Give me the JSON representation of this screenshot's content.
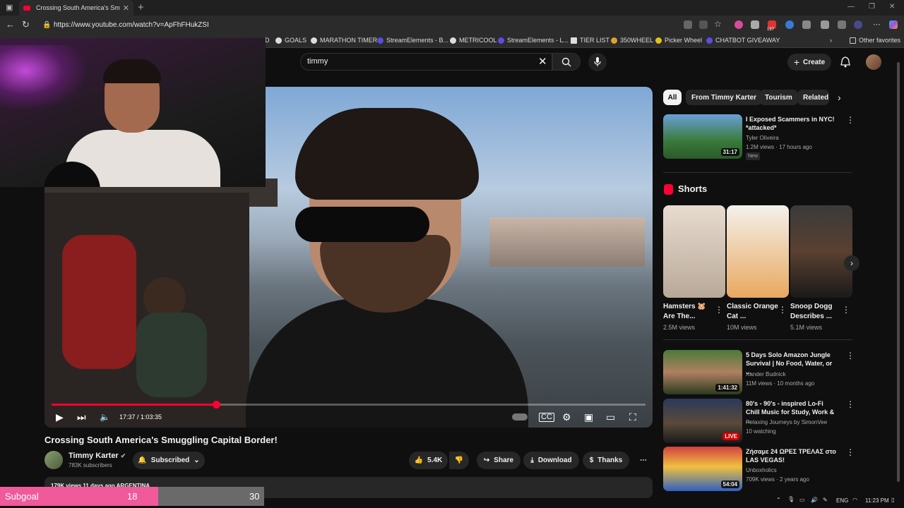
{
  "browser": {
    "tab_title": "Crossing South America's Smugg",
    "url": "https://www.youtube.com/watch?v=ApFhFHukZSI",
    "bookmarks": [
      "GOALS",
      "MARATHON TIMER",
      "StreamElements - B...",
      "METRICOOL",
      "StreamElements - L...",
      "TIER LIST",
      "350WHEEL",
      "Picker Wheel",
      "CHATBOT GIVEAWAY"
    ],
    "other_favorites": "Other favorites",
    "ext_badge": "197"
  },
  "header": {
    "search_value": "timmy",
    "create_label": "Create"
  },
  "player": {
    "time": "17:37 / 1:03:35",
    "progress": 0.277
  },
  "video": {
    "title": "Crossing South America's Smuggling Capital Border!",
    "channel": "Timmy Karter",
    "subscribers": "783K subscribers",
    "subscribed_label": "Subscribed",
    "likes": "5.4K",
    "share_label": "Share",
    "download_label": "Download",
    "thanks_label": "Thanks",
    "description_line": "179K views  11 days ago  ARGENTINA"
  },
  "sidebar": {
    "chips": [
      "All",
      "From Timmy Karter",
      "Tourism",
      "Related"
    ],
    "top_video": {
      "title": "I Exposed Scammers in NYC! *attacked*",
      "channel": "Tyler Oliveira",
      "meta": "1.2M views · 17 hours ago",
      "badge": "New",
      "duration": "31:17"
    },
    "shorts_label": "Shorts",
    "shorts": [
      {
        "title": "Hamsters 🐹 Are The...",
        "views": "2.5M views"
      },
      {
        "title": "Classic Orange Cat ...",
        "views": "10M views"
      },
      {
        "title": "Snoop Dogg Describes ...",
        "views": "5.1M views"
      }
    ],
    "videos": [
      {
        "title": "5 Days Solo Amazon Jungle Survival | No Food, Water, or ...",
        "channel": "Xander Budnick",
        "meta": "11M views · 10 months ago",
        "duration": "1:41:32"
      },
      {
        "title": "80's - 90's - inspired Lo-Fi Chill Music for Study, Work & ...",
        "channel": "Relaxing Journeys by SimonVee",
        "meta": "10 watching",
        "duration": "LIVE"
      },
      {
        "title": "Ζήσαμε 24 ΩΡΕΣ ΤΡΕΛΑΣ στο LAS VEGAS!",
        "channel": "Unboxholics",
        "meta": "709K views · 2 years ago",
        "duration": "54:04"
      }
    ]
  },
  "overlay": {
    "subgoal_label": "Subgoal",
    "current": "18",
    "target": "30"
  },
  "taskbar": {
    "lang": "ENG",
    "time": "11:23 PM"
  }
}
